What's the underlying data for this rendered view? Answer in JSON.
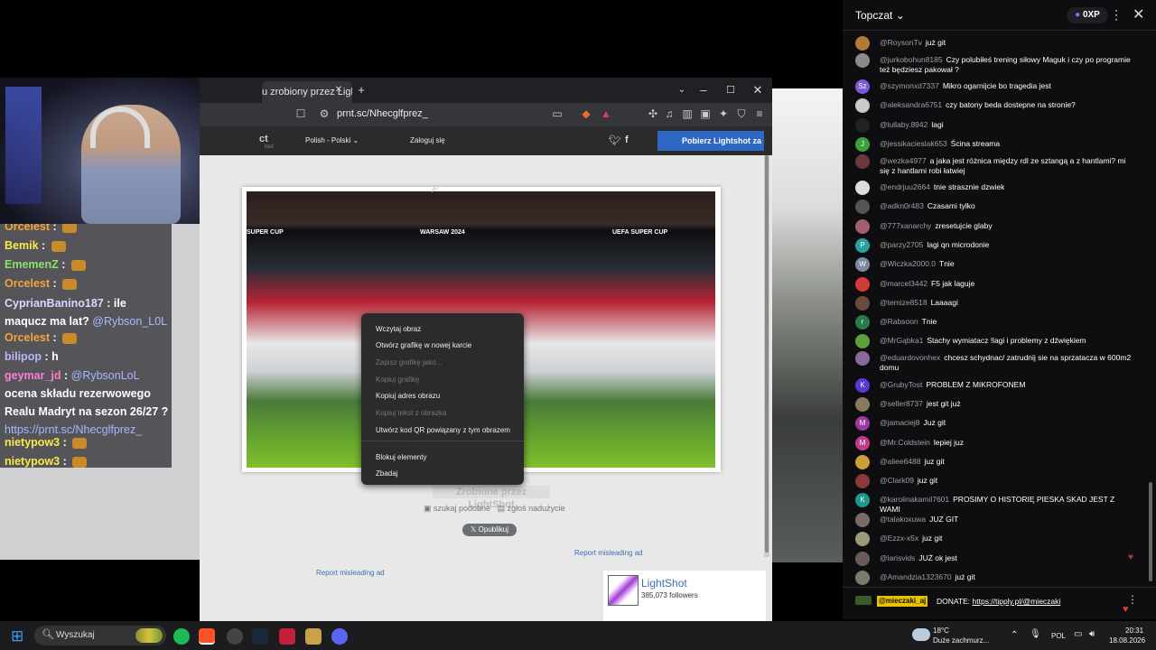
{
  "left_chat": [
    {
      "user": "Orcelest",
      "text": "",
      "emote": true
    },
    {
      "user": "Bemik",
      "text": "",
      "emote": true
    },
    {
      "user": "EmemenZ",
      "text": "",
      "emote": true
    },
    {
      "user": "Orcelest",
      "text": "",
      "emote": true
    },
    {
      "user": "CyprianBanino187",
      "text": "ile maqucz ma lat?",
      "mention": "@Rybson_L0L"
    },
    {
      "user": "Orcelest",
      "text": "",
      "emote": true
    },
    {
      "user": "bilipop",
      "text": "h"
    },
    {
      "user": "geymar_jd",
      "mention": "@RybsonLoL",
      "text": "ocena składu rezerwowego Realu Madryt na sezon 26/27 ?",
      "link": "https://prnt.sc/Nhecglfprez_"
    },
    {
      "user": "nietypow3",
      "text": "",
      "emote": true
    },
    {
      "user": "nietypow3",
      "text": "",
      "emote": true
    }
  ],
  "browser": {
    "tab_title": "u zrobiony przez Ligh",
    "new_tab": "+",
    "url": "prnt.sc/Nhecglfprez_",
    "site_lang": "Polish - Polski",
    "site_login": "Zaloguj się",
    "site_download": "Pobierz Lightshot za da",
    "site_logo_partial": "ct",
    "site_logo_sub": "tool",
    "image_labels": [
      "SUPER CUP",
      "WARSAW 2024",
      "UEFA SUPER CUP"
    ],
    "made_by": "Zrobione przez LightShot",
    "search_similar": "szukaj podobne",
    "report": "zgłoś nadużycie",
    "publish": "Opublikuj",
    "report_ad_1": "Report misleading ad",
    "report_ad_2": "Report misleading ad",
    "ls_name": "LightShot",
    "ls_followers": "385,073 followers"
  },
  "context_menu": [
    {
      "label": "Wczytaj obraz",
      "disabled": false
    },
    {
      "label": "Otwórz grafikę w nowej karcie",
      "disabled": false
    },
    {
      "label": "Zapisz grafikę jako...",
      "disabled": true
    },
    {
      "label": "Kopiuj grafikę",
      "disabled": true
    },
    {
      "label": "Kopiuj adres obrazu",
      "disabled": false
    },
    {
      "label": "Kopiuj tekst z obrazka",
      "disabled": true
    },
    {
      "label": "Utwórz kod QR powiązany z tym obrazem",
      "disabled": false
    },
    {
      "label": "Blokuj elementy",
      "disabled": false
    },
    {
      "label": "Zbadaj",
      "disabled": false
    }
  ],
  "right_chat": {
    "title": "Topczat",
    "xp": "0XP",
    "messages": [
      {
        "user": "@RoysonTv",
        "text": "już git",
        "color": "#b07a3a"
      },
      {
        "user": "@jurkobohun8185",
        "text": "Czy polubiłeś trening siłowy Maguk i czy po programie też będziesz pakował ?",
        "color": "#8a8a8a",
        "two": true
      },
      {
        "user": "@szymonxd7337",
        "text": "Mikro ogarnijcie bo tragedia jest",
        "color": "#7a5ad6",
        "initial": "Sz"
      },
      {
        "user": "@aleksandra6751",
        "text": "czy batony beda dostepne na stronie?",
        "color": "#c9c9c9"
      },
      {
        "user": "@lullaby.8942",
        "text": "lagi",
        "color": "#222"
      },
      {
        "user": "@jessikacieslak653",
        "text": "Ścina streama",
        "color": "#3aa13a",
        "initial": "J"
      },
      {
        "user": "@wezka4977",
        "text": "a jaka jest różnica między rdl ze sztangą a z hantlami? mi się z hantlami robi łatwiej",
        "color": "#6a3a3a",
        "two": true
      },
      {
        "user": "@endrjuu2664",
        "text": "tnie strasznie dzwiek",
        "color": "#ddd"
      },
      {
        "user": "@adkn0r483",
        "text": "Czasami tylko",
        "color": "#555"
      },
      {
        "user": "@777xanarchy",
        "text": "zresetujcie glaby",
        "color": "#a06070"
      },
      {
        "user": "@parzy2705",
        "text": "lagi qn microdonie",
        "color": "#2aa1a1",
        "initial": "P"
      },
      {
        "user": "@Wiczka2000.0",
        "text": "Tnie",
        "color": "#7a8aa0",
        "initial": "W"
      },
      {
        "user": "@marcel3442",
        "text": "F5 jak laguje",
        "color": "#d23a3a"
      },
      {
        "user": "@temize8518",
        "text": "Laaaagi",
        "color": "#6a4a3a"
      },
      {
        "user": "@Rabsoon",
        "text": "Tnie",
        "color": "#2a7a4a",
        "initial": "r"
      },
      {
        "user": "@MrGąbka1",
        "text": "Stachy wymiatacz !lagi i problemy z dźwiękiem",
        "color": "#5aa13a"
      },
      {
        "user": "@eduardovonhex",
        "text": "chcesz schydnac/ zatrudnij sie na sprzatacza w 600m2 domu",
        "color": "#8a6a9a",
        "two": true
      },
      {
        "user": "@GrubyTost",
        "text": "PROBLEM Z MIKROFONEM",
        "color": "#5a3ad6",
        "initial": "K"
      },
      {
        "user": "@seller8737",
        "text": "jest git już",
        "color": "#8a7a5a"
      },
      {
        "user": "@jamaciej8",
        "text": "Juz git",
        "color": "#9a3aa1",
        "initial": "M"
      },
      {
        "user": "@Mr.Coldstein",
        "text": "lepiej juz",
        "color": "#c23a8a",
        "initial": "M"
      },
      {
        "user": "@aliee6488",
        "text": "juz git",
        "color": "#c9a13a"
      },
      {
        "user": "@Clark09",
        "text": "juz git",
        "color": "#8a3a3a"
      },
      {
        "user": "@karolinakamil7601",
        "text": "PROSIMY O HISTORIĘ PIESKA SKAD JEST Z WAMI",
        "color": "#1a9a8a",
        "initial": "K"
      },
      {
        "user": "@talakoxuwa",
        "text": "JUZ GIT",
        "color": "#7a6a6a"
      },
      {
        "user": "@Ezzx-x5x",
        "text": "juz git",
        "color": "#9a9a7a"
      },
      {
        "user": "@larisvids",
        "text": "JUŻ ok jest",
        "color": "#6a5a5a",
        "heart": true
      },
      {
        "user": "@Amandzia1323670",
        "text": "już git",
        "color": "#7a7a6a"
      }
    ],
    "donate_user": "@mieczaki_aj",
    "donate_text": "DONATE:",
    "donate_link": "https://tipply.pl/@mieczaki"
  },
  "taskbar": {
    "search_placeholder": "Wyszukaj",
    "weather_temp": "18°C",
    "weather_desc": "Duże zachmurz...",
    "lang": "POL",
    "time": "20:31",
    "date": "18.08.2026"
  }
}
